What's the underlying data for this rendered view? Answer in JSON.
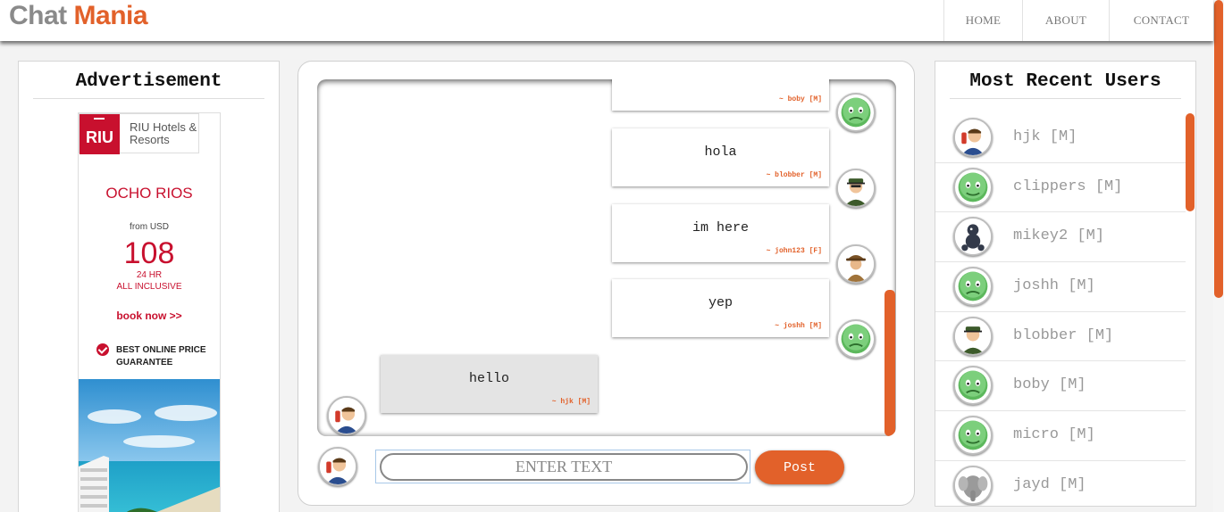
{
  "header": {
    "logo_part1": "Chat",
    "logo_part2": "Mania",
    "nav": [
      {
        "label": "HOME"
      },
      {
        "label": "ABOUT"
      },
      {
        "label": "CONTACT"
      }
    ]
  },
  "ad": {
    "title": "Advertisement",
    "brand_logo": "RIU",
    "brand_name": "RIU Hotels & Resorts",
    "city": "OCHO RIOS",
    "from": "from USD",
    "price": "108",
    "hours": "24 HR",
    "inclusive": "ALL INCLUSIVE",
    "cta": "book now >>",
    "guarantee": "BEST ONLINE PRICE GUARANTEE"
  },
  "chat": {
    "messages": [
      {
        "text": "",
        "meta": "~ boby [M]",
        "avatar": "green-smiley-icon",
        "side": "right"
      },
      {
        "text": "hola",
        "meta": "~ blobber [M]",
        "avatar": "officer-icon",
        "side": "right"
      },
      {
        "text": "im here",
        "meta": "~ john123 [F]",
        "avatar": "detective-icon",
        "side": "right"
      },
      {
        "text": "yep",
        "meta": "~ joshh [M]",
        "avatar": "green-smiley-icon",
        "side": "right"
      },
      {
        "text": "hello",
        "meta": "~ hjk [M]",
        "avatar": "businessman-phone-icon",
        "side": "left"
      }
    ],
    "input_placeholder": "ENTER TEXT",
    "post_label": "Post"
  },
  "users": {
    "title": "Most Recent Users",
    "items": [
      {
        "name": "hjk [M]",
        "avatar": "businessman-phone-icon"
      },
      {
        "name": "clippers [M]",
        "avatar": "green-smiley-icon"
      },
      {
        "name": "mikey2 [M]",
        "avatar": "poodle-icon"
      },
      {
        "name": "joshh [M]",
        "avatar": "green-smiley-icon"
      },
      {
        "name": "blobber [M]",
        "avatar": "officer-icon"
      },
      {
        "name": "boby [M]",
        "avatar": "green-smiley-icon"
      },
      {
        "name": "micro [M]",
        "avatar": "green-smiley-icon"
      },
      {
        "name": "jayd [M]",
        "avatar": "elephant-icon"
      }
    ]
  },
  "colors": {
    "accent": "#e2612a",
    "logo_gray": "#8a8a8a",
    "brand_red": "#c8102e"
  }
}
